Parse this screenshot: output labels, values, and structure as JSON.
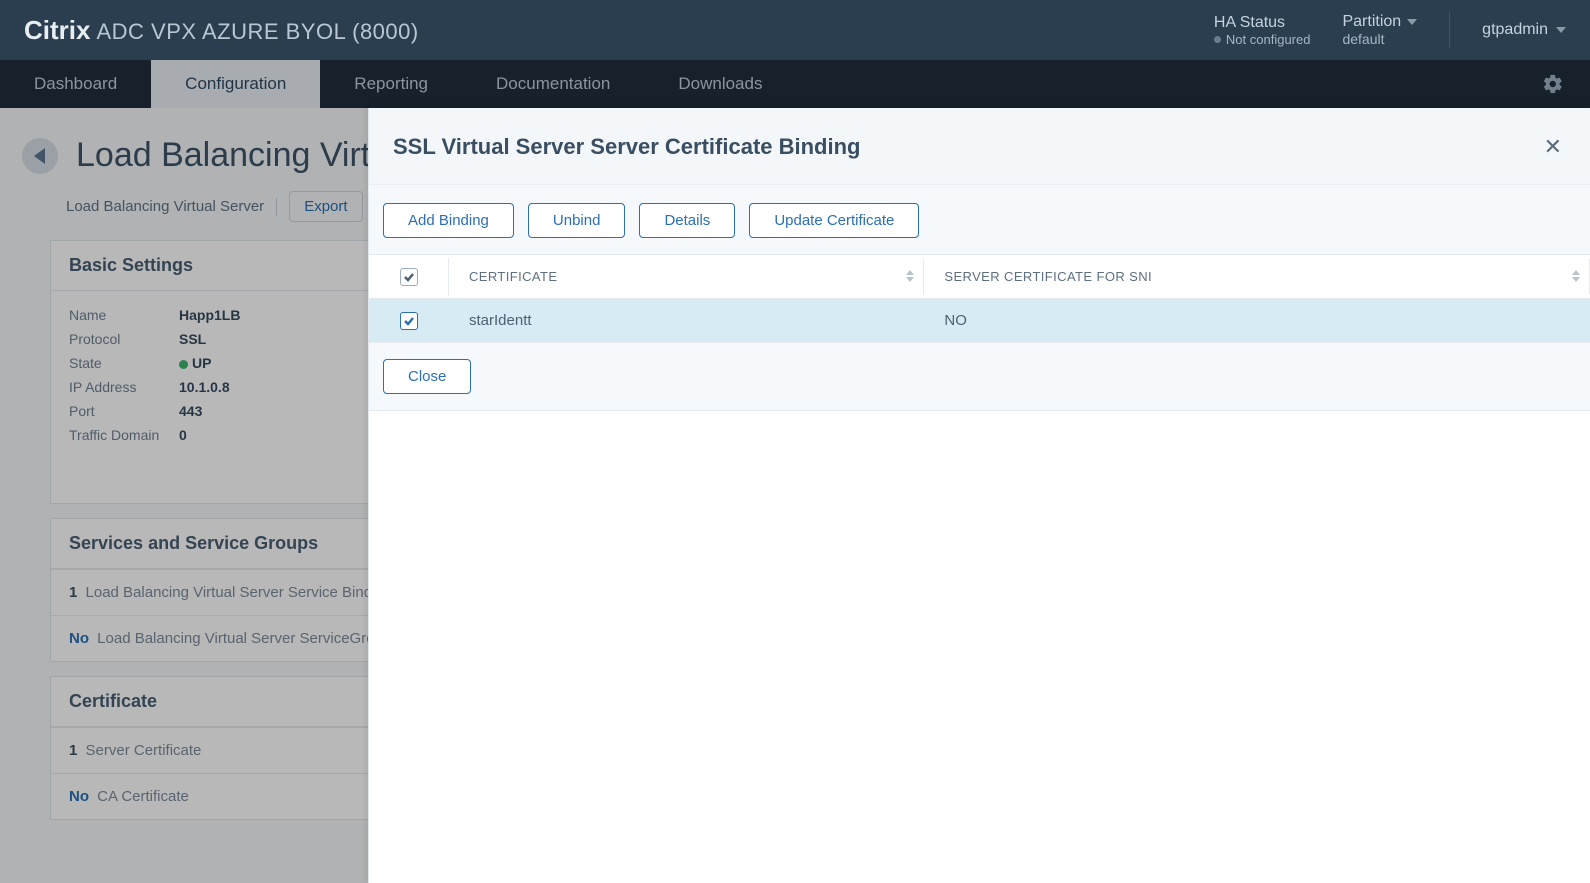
{
  "brand": {
    "citrix": "Citrix",
    "product": "ADC VPX AZURE BYOL (8000)"
  },
  "topbar": {
    "ha_label": "HA Status",
    "ha_value": "Not configured",
    "partition_label": "Partition",
    "partition_value": "default",
    "user": "gtpadmin"
  },
  "nav": {
    "dashboard": "Dashboard",
    "configuration": "Configuration",
    "reporting": "Reporting",
    "documentation": "Documentation",
    "downloads": "Downloads"
  },
  "page": {
    "title": "Load Balancing Virtual",
    "breadcrumb": "Load Balancing Virtual Server",
    "export": "Export"
  },
  "basic": {
    "header": "Basic Settings",
    "labels": {
      "name": "Name",
      "protocol": "Protocol",
      "state": "State",
      "ip": "IP Address",
      "port": "Port",
      "domain": "Traffic Domain"
    },
    "values": {
      "name": "Happ1LB",
      "protocol": "SSL",
      "state": "UP",
      "ip": "10.1.0.8",
      "port": "443",
      "domain": "0"
    }
  },
  "services": {
    "header": "Services and Service Groups",
    "row1_count": "1",
    "row1_text": "Load Balancing Virtual Server Service Bindi",
    "row2_count": "No",
    "row2_text": "Load Balancing Virtual Server ServiceGrou"
  },
  "cert": {
    "header": "Certificate",
    "row1_count": "1",
    "row1_text": "Server Certificate",
    "row2_count": "No",
    "row2_text": "CA Certificate"
  },
  "overlay": {
    "title": "SSL Virtual Server Server Certificate Binding",
    "buttons": {
      "add": "Add Binding",
      "unbind": "Unbind",
      "details": "Details",
      "update": "Update Certificate",
      "close": "Close"
    },
    "columns": {
      "certificate": "CERTIFICATE",
      "sni": "SERVER CERTIFICATE FOR SNI"
    },
    "row": {
      "certificate": "starIdentt",
      "sni": "NO"
    }
  }
}
